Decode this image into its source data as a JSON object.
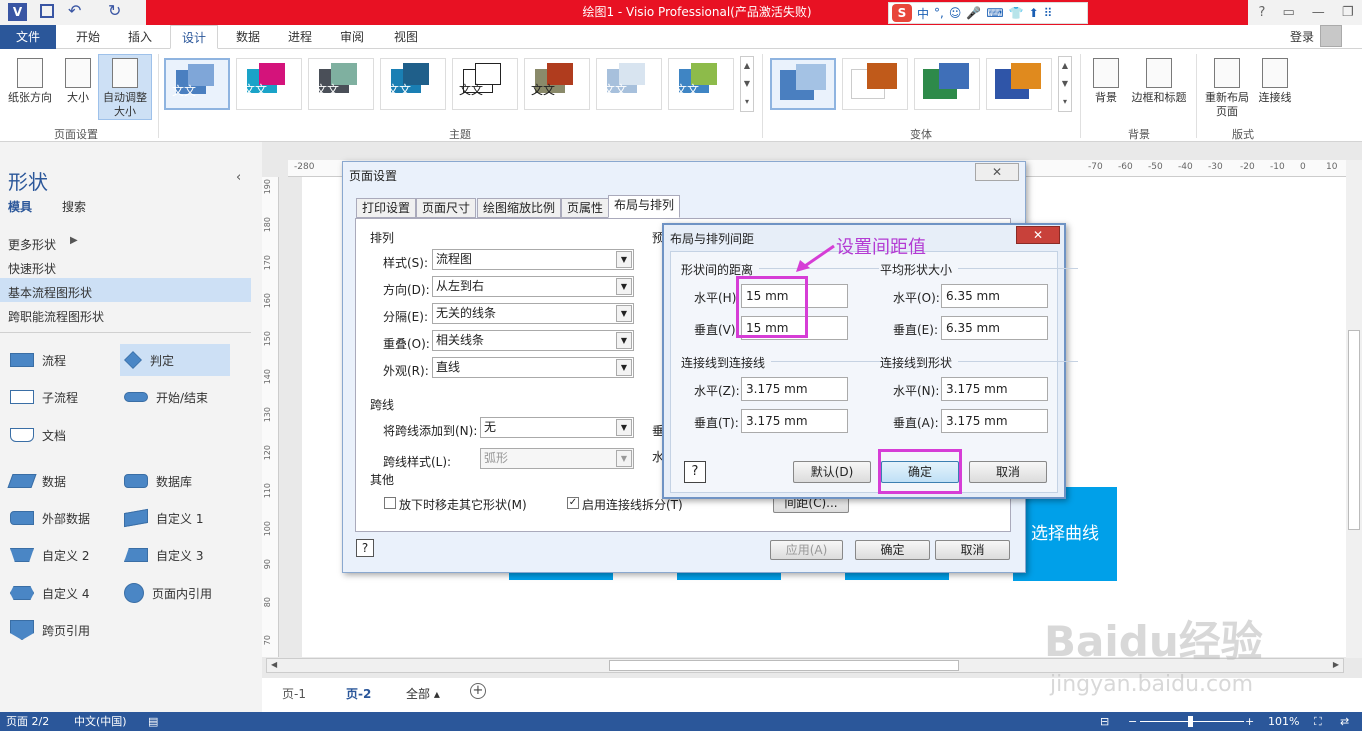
{
  "app": {
    "title": "绘图1 - Visio Professional(产品激活失败)",
    "app_icon": "V"
  },
  "ime": {
    "logo": "S",
    "items": [
      "中",
      "°,",
      "☺",
      "🎤",
      "⌨",
      "👕",
      "⬆",
      "⠿"
    ]
  },
  "menu": {
    "tabs": [
      "文件",
      "开始",
      "插入",
      "设计",
      "数据",
      "进程",
      "审阅",
      "视图"
    ],
    "login": "登录"
  },
  "ribbon": {
    "page_setup": {
      "orientation": "纸张方向",
      "size": "大小",
      "autosize_1": "自动调整",
      "autosize_2": "大小",
      "group": "页面设置"
    },
    "themes_group": "主题",
    "theme_text": "文文",
    "variants_group": "变体",
    "background": "背景",
    "borders": "边框和标题",
    "bg_group": "背景",
    "relayout_1": "重新布局",
    "relayout_2": "页面",
    "connectors": "连接线",
    "layout_group": "版式"
  },
  "shapes_panel": {
    "title": "形状",
    "tab_stencils": "模具",
    "tab_search": "搜索",
    "more_shapes": "更多形状",
    "quick_shapes": "快速形状",
    "basic_flowchart": "基本流程图形状",
    "cross_functional": "跨职能流程图形状",
    "items": [
      {
        "left": "流程",
        "right": "判定"
      },
      {
        "left": "子流程",
        "right": "开始/结束"
      },
      {
        "left": "文档",
        "right": ""
      },
      {
        "left": "数据",
        "right": "数据库"
      },
      {
        "left": "外部数据",
        "right": "自定义 1"
      },
      {
        "left": "自定义 2",
        "right": "自定义 3"
      },
      {
        "left": "自定义 4",
        "right": "页面内引用"
      },
      {
        "left": "跨页引用",
        "right": ""
      }
    ]
  },
  "ruler": {
    "h_ticks": [
      "-280",
      "-70",
      "-60",
      "-50",
      "-40",
      "-30",
      "-20",
      "-10",
      "0",
      "10"
    ],
    "v_ticks": [
      "190",
      "180",
      "170",
      "160",
      "150",
      "140",
      "130",
      "120",
      "110",
      "100",
      "90",
      "80",
      "70"
    ]
  },
  "canvas": {
    "select_curve": "选择曲线"
  },
  "page_tabs": {
    "tab1": "页-1",
    "tab2": "页-2",
    "all": "全部"
  },
  "status": {
    "page": "页面 2/2",
    "lang": "中文(中国)",
    "zoom": "101%"
  },
  "page_setup_dialog": {
    "title": "页面设置",
    "tabs": [
      "打印设置",
      "页面尺寸",
      "绘图缩放比例",
      "页属性",
      "布局与排列"
    ],
    "arrange_section": "排列",
    "style_label": "样式(S):",
    "style_value": "流程图",
    "direction_label": "方向(D):",
    "direction_value": "从左到右",
    "separation_label": "分隔(E):",
    "separation_value": "无关的线条",
    "overlap_label": "重叠(O):",
    "overlap_value": "相关线条",
    "appearance_label": "外观(R):",
    "appearance_value": "直线",
    "preview_prefix": "预",
    "jump_section": "跨线",
    "jump_add_label": "将跨线添加到(N):",
    "jump_add_value": "无",
    "jump_style_label": "跨线样式(L):",
    "jump_style_value": "弧形",
    "vert_prefix": "垂",
    "horiz_prefix": "水",
    "other_section": "其他",
    "move_others": "放下时移走其它形状(M)",
    "split_connectors": "启用连接线拆分(T)",
    "spacing_button": "间距(C)...",
    "apply": "应用(A)",
    "ok": "确定",
    "cancel": "取消"
  },
  "spacing_dialog": {
    "title": "布局与排列间距",
    "between_shapes": "形状间的距离",
    "avg_shape_size": "平均形状大小",
    "h_label": "水平(H)",
    "h_value": "15 mm",
    "v_label": "垂直(V)",
    "v_value": "15 mm",
    "avg_h_label": "水平(O):",
    "avg_h_value": "6.35 mm",
    "avg_v_label": "垂直(E):",
    "avg_v_value": "6.35 mm",
    "conn_to_conn": "连接线到连接线",
    "cc_h_label": "水平(Z):",
    "cc_h_value": "3.175 mm",
    "cc_v_label": "垂直(T):",
    "cc_v_value": "3.175 mm",
    "conn_to_shape": "连接线到形状",
    "cs_h_label": "水平(N):",
    "cs_h_value": "3.175 mm",
    "cs_v_label": "垂直(A):",
    "cs_v_value": "3.175 mm",
    "default": "默认(D)",
    "ok": "确定",
    "cancel": "取消"
  },
  "annotation": "设置间距值",
  "watermark": {
    "brand": "Bai",
    "paw": "du",
    "cn": "经验",
    "url": "jingyan.baidu.com"
  },
  "colors": {
    "accent": "#2b579a",
    "title_red": "#e81123",
    "highlight": "#d63dd6",
    "shape_blue": "#00a0e9"
  }
}
